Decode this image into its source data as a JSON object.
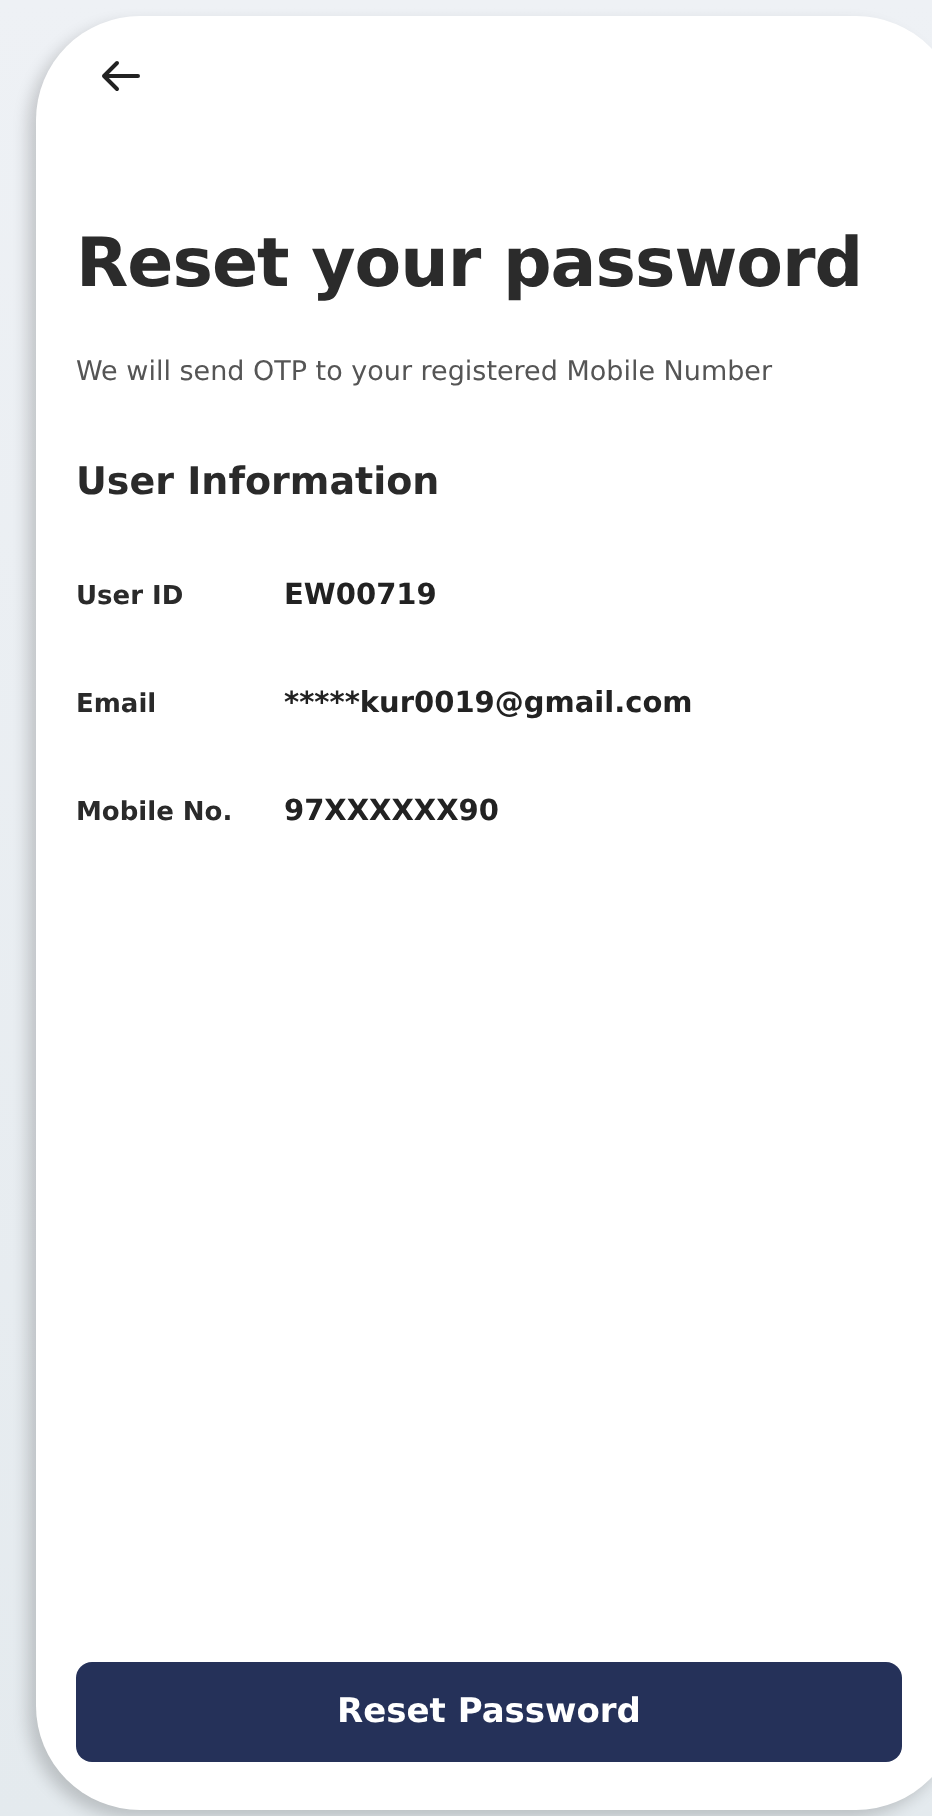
{
  "header": {
    "title": "Reset your password",
    "subtitle": "We will send OTP to your registered Mobile Number"
  },
  "section": {
    "title": "User Information",
    "fields": [
      {
        "label": "User ID",
        "value": "EW00719"
      },
      {
        "label": "Email",
        "value": "*****kur0019@gmail.com"
      },
      {
        "label": "Mobile No.",
        "value": "97XXXXXX90"
      }
    ]
  },
  "button": {
    "label": "Reset Password"
  }
}
